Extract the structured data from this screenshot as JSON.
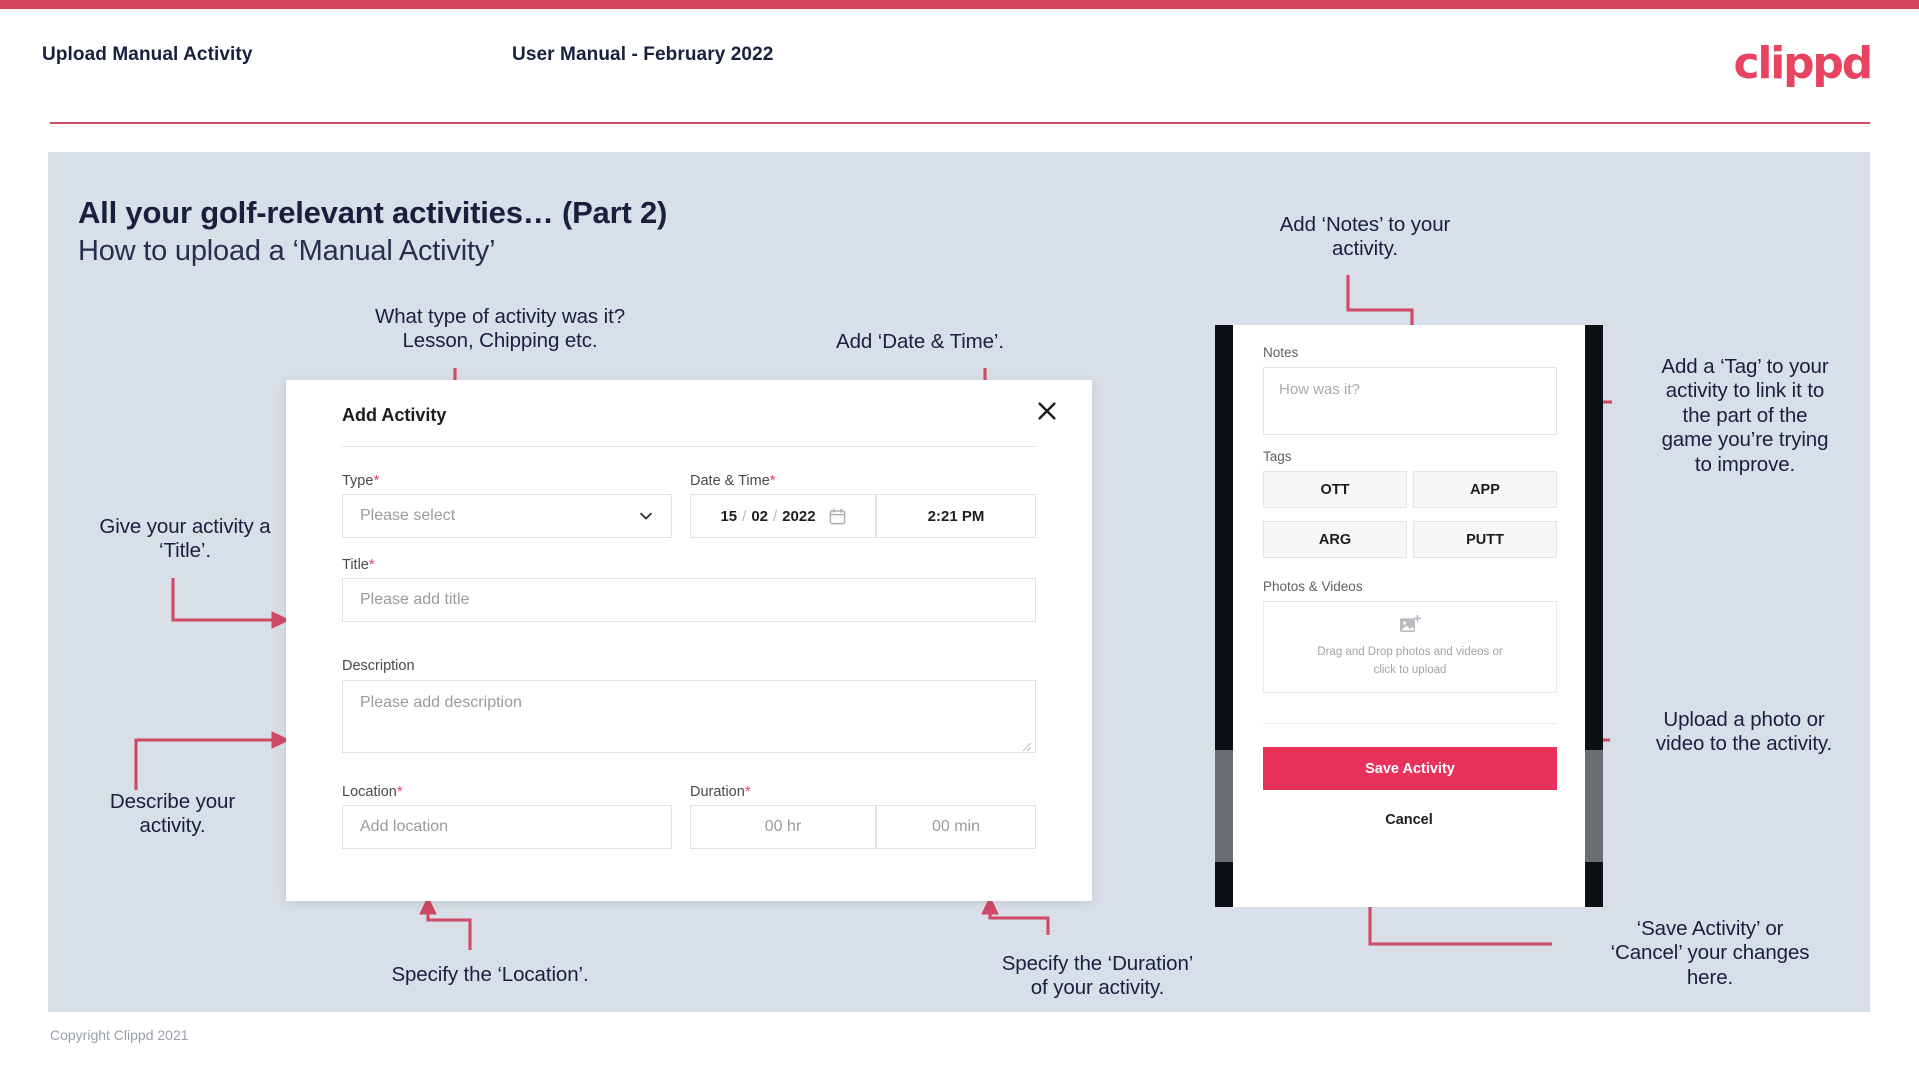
{
  "header": {
    "left_title": "Upload Manual Activity",
    "center_title": "User Manual - February 2022",
    "logo_text": "clippd"
  },
  "slide": {
    "title": "All your golf-relevant activities… (Part 2)",
    "subtitle": "How to upload a ‘Manual Activity’",
    "copyright": "Copyright Clippd 2021"
  },
  "colors": {
    "brand_crimson": "#d2445c",
    "logo_pink": "#e8435f",
    "save_pink": "#e8325b",
    "canvas_grey": "#d9dfe8",
    "navy_text": "#17203d",
    "arrow_red": "#cf4a64"
  },
  "annotations": [
    {
      "id": "type",
      "text": "What type of activity was it?\nLesson, Chipping etc."
    },
    {
      "id": "datetime",
      "text": "Add ‘Date & Time’."
    },
    {
      "id": "title",
      "text": "Give your activity a\n‘Title’."
    },
    {
      "id": "description",
      "text": "Describe your\nactivity."
    },
    {
      "id": "location",
      "text": "Specify the ‘Location’."
    },
    {
      "id": "duration",
      "text": "Specify the ‘Duration’\nof your activity."
    },
    {
      "id": "notes",
      "text": "Add ‘Notes’ to your\nactivity."
    },
    {
      "id": "tags",
      "text": "Add a ‘Tag’ to your\nactivity to link it to\nthe part of the\ngame you’re trying\nto improve."
    },
    {
      "id": "upload",
      "text": "Upload a photo or\nvideo to the activity."
    },
    {
      "id": "save",
      "text": "‘Save Activity’ or\n‘Cancel’ your changes\nhere."
    }
  ],
  "dialog": {
    "title": "Add Activity",
    "close_icon": "close-icon",
    "fields": {
      "type": {
        "label": "Type",
        "required": "*",
        "placeholder": "Please select",
        "chevron_icon": "chevron-down-icon"
      },
      "datetime": {
        "label": "Date & Time",
        "required": "*",
        "day": "15",
        "sep1": "/",
        "month": "02",
        "sep2": "/",
        "year": "2022",
        "calendar_icon": "calendar-icon",
        "time": "2:21 PM"
      },
      "title": {
        "label": "Title",
        "required": "*",
        "placeholder": "Please add title"
      },
      "description": {
        "label": "Description",
        "required": "",
        "placeholder": "Please add description"
      },
      "location": {
        "label": "Location",
        "required": "*",
        "placeholder": "Add location"
      },
      "duration": {
        "label": "Duration",
        "required": "*",
        "hours_placeholder": "00 hr",
        "minutes_placeholder": "00 min"
      }
    }
  },
  "phone": {
    "notes": {
      "label": "Notes",
      "placeholder": "How was it?"
    },
    "tags": {
      "label": "Tags",
      "items": [
        "OTT",
        "APP",
        "ARG",
        "PUTT"
      ]
    },
    "photos": {
      "label": "Photos & Videos",
      "icon": "add-image-icon",
      "drop_text": "Drag and Drop photos and videos or\nclick to upload"
    },
    "save_label": "Save Activity",
    "cancel_label": "Cancel"
  }
}
